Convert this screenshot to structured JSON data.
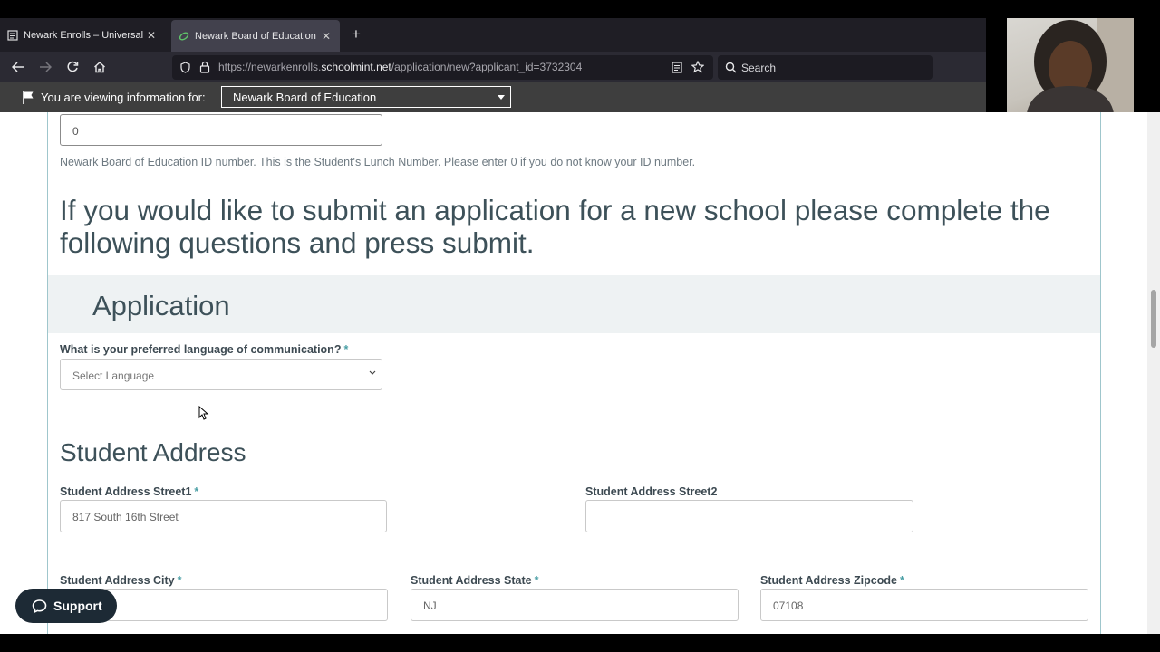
{
  "browser": {
    "tabs": [
      {
        "label": "Newark Enrolls – Universal Enrol",
        "close": "✕"
      },
      {
        "label": "Newark Board of Education | Sc",
        "close": "✕"
      }
    ],
    "new_tab": "+",
    "url_prefix": "https://newarkenrolls.",
    "url_domain": "schoolmint.net",
    "url_path": "/application/new?applicant_id=3732304",
    "search_placeholder": "Search"
  },
  "org_bar": {
    "label": "You are viewing information for:",
    "selected": "Newark Board of Education"
  },
  "form": {
    "id_value": "0",
    "id_help": "Newark Board of Education ID number. This is the Student's Lunch Number. Please enter 0 if you do not know your ID number.",
    "intro": "If you would like to submit an application for a new school please complete the following questions and press submit.",
    "application_heading": "Application",
    "language_label": "What is your preferred language of communication?",
    "language_placeholder": "Select Language",
    "address_heading": "Student Address",
    "street1_label": "Student Address Street1",
    "street1_value": "817 South 16th Street",
    "street2_label": "Student Address Street2",
    "street2_value": "",
    "city_label": "Student Address City",
    "city_value": "",
    "state_label": "Student Address State",
    "state_value": "NJ",
    "zip_label": "Student Address Zipcode",
    "zip_value": "07108",
    "required_mark": "*"
  },
  "support": {
    "label": "Support"
  },
  "colors": {
    "accent": "#4a9fa5",
    "heading": "#3d5159",
    "support_bg": "#1d2a35"
  }
}
